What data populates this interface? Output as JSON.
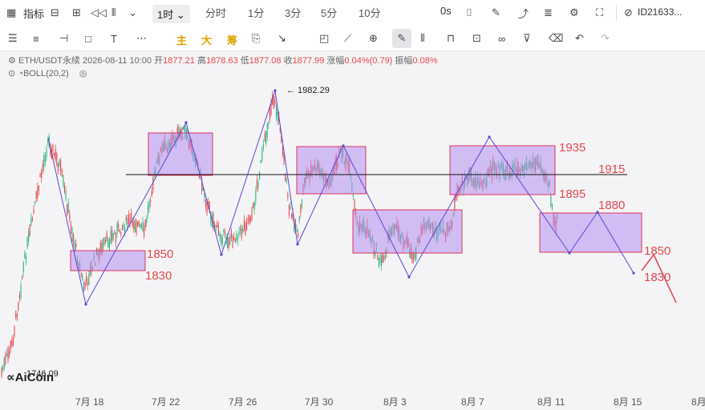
{
  "toolbar_top": {
    "indicator_label": "指标",
    "timeframe_selected": "1时",
    "timeframes": [
      "分时",
      "1分",
      "3分",
      "5分",
      "10分"
    ],
    "seconds_label": "0s",
    "account_id": "ID21633..."
  },
  "toolbar_draw": {
    "labels": [
      "主",
      "大",
      "筹"
    ]
  },
  "ohlc": {
    "symbol": "ETH/USDT永续",
    "datetime": "2026-08-11 10:00",
    "open_label": "开",
    "open": "1877.21",
    "high_label": "高",
    "high": "1878.63",
    "low_label": "低",
    "low": "1877.08",
    "close_label": "收",
    "close": "1877.99",
    "change_label": "涨幅",
    "change": "0.04%(0.79)",
    "amp_label": "振幅",
    "amp": "0.08%"
  },
  "indicator": {
    "name": "BOLL(20,2)"
  },
  "chart_data": {
    "type": "candlestick-annotated",
    "x_ticks": [
      "7月 18",
      "7月 22",
      "7月 26",
      "7月 30",
      "8月 3",
      "8月 7",
      "8月 11",
      "8月 15",
      "8月"
    ],
    "peak_label": "1982.29",
    "left_bottom_label": "1746.09",
    "horizontal_line": {
      "label": "1915",
      "value": 1915
    },
    "level_labels": [
      {
        "text": "1850",
        "color": "#e5484d"
      },
      {
        "text": "1830",
        "color": "#e5484d"
      },
      {
        "text": "1935",
        "color": "#e5484d"
      },
      {
        "text": "1895",
        "color": "#e5484d"
      },
      {
        "text": "1880",
        "color": "#e5484d"
      },
      {
        "text": "1850",
        "color": "#e5484d"
      },
      {
        "text": "1830",
        "color": "#e5484d"
      }
    ],
    "colors": {
      "up": "#2bb57e",
      "down": "#e5484d",
      "box_fill": "#b48ff0",
      "box_stroke": "#e0325c",
      "path": "#5a45d8"
    }
  },
  "watermark": "AiCoin"
}
